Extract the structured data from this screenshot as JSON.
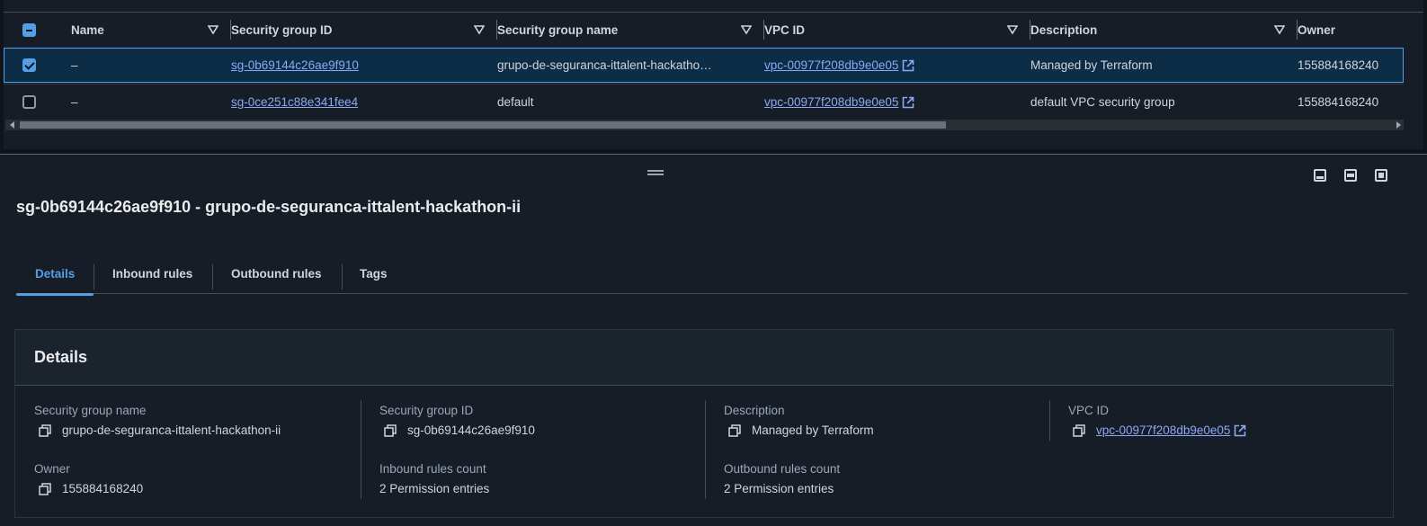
{
  "table": {
    "columns": [
      {
        "label": "Name"
      },
      {
        "label": "Security group ID"
      },
      {
        "label": "Security group name"
      },
      {
        "label": "VPC ID"
      },
      {
        "label": "Description"
      },
      {
        "label": "Owner"
      }
    ],
    "rows": [
      {
        "selected": true,
        "name": "–",
        "sg_id": "sg-0b69144c26ae9f910",
        "sg_name": "grupo-de-seguranca-ittalent-hackatho…",
        "vpc_id": "vpc-00977f208db9e0e05",
        "description": "Managed by Terraform",
        "owner": "155884168240"
      },
      {
        "selected": false,
        "name": "–",
        "sg_id": "sg-0ce251c88e341fee4",
        "sg_name": "default",
        "vpc_id": "vpc-00977f208db9e0e05",
        "description": "default VPC security group",
        "owner": "155884168240"
      }
    ]
  },
  "split_panel": {
    "title": "sg-0b69144c26ae9f910 - grupo-de-seguranca-ittalent-hackathon-ii",
    "tabs": [
      {
        "label": "Details",
        "active": true
      },
      {
        "label": "Inbound rules",
        "active": false
      },
      {
        "label": "Outbound rules",
        "active": false
      },
      {
        "label": "Tags",
        "active": false
      }
    ],
    "details": {
      "header": "Details",
      "sg_name_label": "Security group name",
      "sg_name_value": "grupo-de-seguranca-ittalent-hackathon-ii",
      "sg_id_label": "Security group ID",
      "sg_id_value": "sg-0b69144c26ae9f910",
      "description_label": "Description",
      "description_value": "Managed by Terraform",
      "vpc_label": "VPC ID",
      "vpc_value": "vpc-00977f208db9e0e05",
      "owner_label": "Owner",
      "owner_value": "155884168240",
      "inbound_label": "Inbound rules count",
      "inbound_value": "2 Permission entries",
      "outbound_label": "Outbound rules count",
      "outbound_value": "2 Permission entries"
    }
  },
  "colors": {
    "accent": "#539fe5",
    "link": "#89a9f5",
    "background": "#0f141a",
    "panel": "#161d26"
  }
}
